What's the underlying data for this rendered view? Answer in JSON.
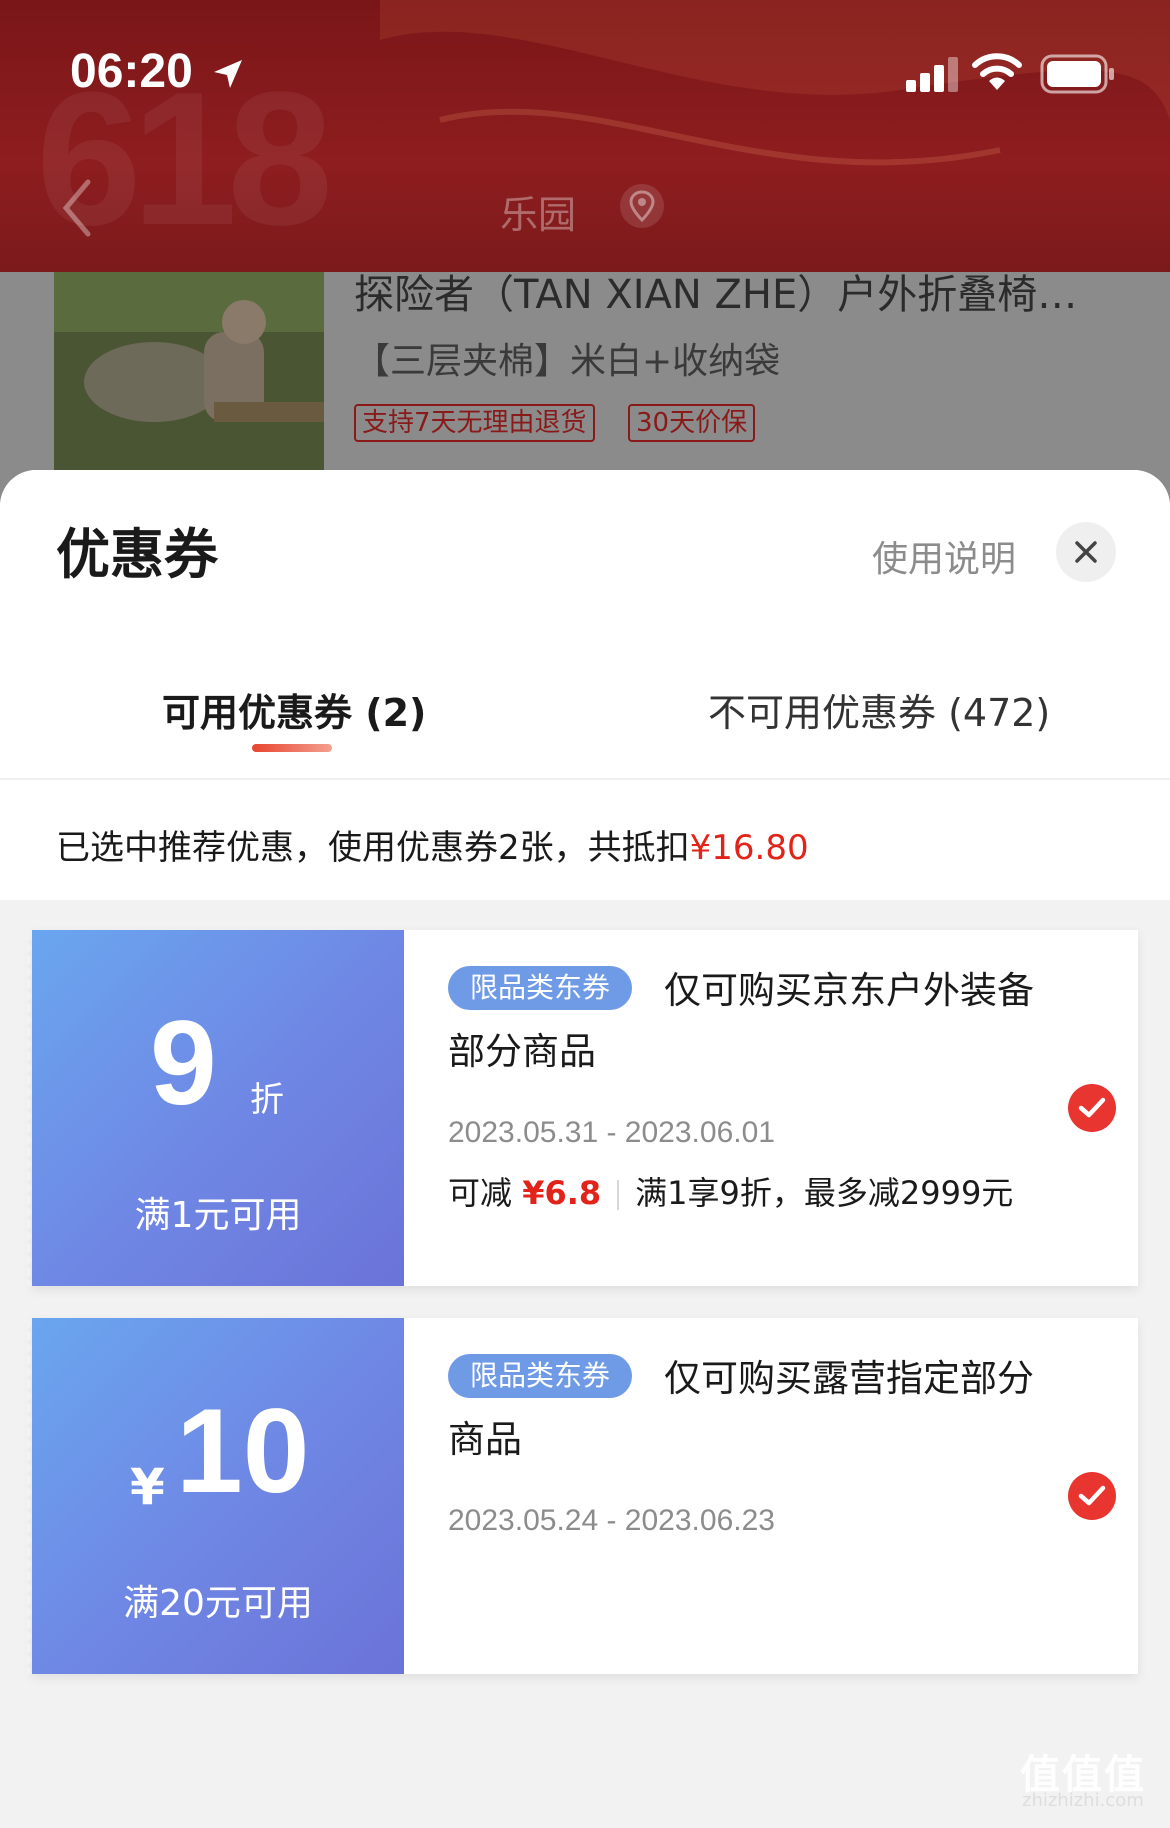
{
  "status_bar": {
    "time": "06:20"
  },
  "nav": {
    "title": "乐园",
    "bg_text": "618"
  },
  "product": {
    "title": "探险者（TAN XIAN ZHE）户外折叠椅…",
    "spec": "【三层夹棉】米白+收纳袋",
    "tags": [
      "支持7天无理由退货",
      "30天价保"
    ]
  },
  "sheet": {
    "title": "优惠券",
    "help_label": "使用说明",
    "tabs": [
      {
        "label": "可用优惠券 (2)",
        "active": true
      },
      {
        "label": "不可用优惠券 (472)",
        "active": false
      }
    ],
    "summary_prefix": "已选中推荐优惠，使用优惠券2张，共抵扣",
    "summary_amount": "¥16.80"
  },
  "coupons": [
    {
      "value": "9",
      "unit": "折",
      "condition": "满1元可用",
      "badge": "限品类东券",
      "desc_line1": "仅可购买京东户外装备",
      "desc_line2": "部分商品",
      "dates": "2023.05.31 - 2023.06.01",
      "detail_prefix": "可减",
      "detail_amount": "¥6.8",
      "detail_rule": "满1享9折，最多减2999元",
      "selected": true
    },
    {
      "value": "10",
      "unit": "¥",
      "condition": "满20元可用",
      "badge": "限品类东券",
      "desc_line1": "仅可购买露营指定部分",
      "desc_line2": "商品",
      "dates": "2023.05.24 - 2023.06.23",
      "selected": true
    }
  ],
  "watermark": {
    "main": "值值值",
    "sub": "zhizhizhi.com"
  },
  "colors": {
    "accent_red": "#e2231a",
    "coupon_blue": "#6f86e4",
    "header_red": "#8e1d1f"
  }
}
